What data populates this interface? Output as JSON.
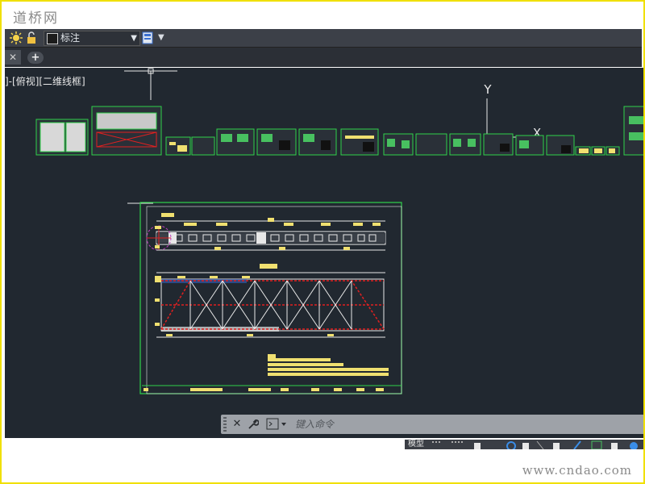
{
  "watermark": {
    "site_name": "道桥网",
    "url": "www.cndao.com"
  },
  "toolbar": {
    "layer_name": "标注"
  },
  "tabs": {
    "close_glyph": "✕",
    "add_glyph": "+"
  },
  "viewport": {
    "label": "]-[俯视][二维线框]"
  },
  "ucs": {
    "y_label": "Y",
    "x_label": "X"
  },
  "command_line": {
    "placeholder": "键入命令"
  },
  "status_bar": {
    "model_tab": "模型"
  },
  "colors": {
    "canvas_bg": "#212830",
    "frame_border": "#f0e000",
    "drawing_green": "#2fd24a",
    "drawing_yellow": "#f0e070",
    "truss_red": "#e02020",
    "ui_dark": "#3c4048"
  },
  "icons": [
    "sun-icon",
    "lock-icon",
    "color-swatch-icon",
    "dropdown-arrow-icon",
    "layer-props-icon",
    "close-icon",
    "wrench-icon",
    "command-prompt-icon"
  ]
}
